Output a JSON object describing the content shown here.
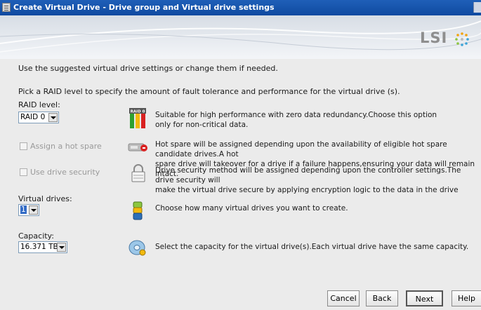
{
  "window": {
    "title": "Create Virtual Drive - Drive group and Virtual drive settings"
  },
  "brand": {
    "logo_text": "LSI"
  },
  "intro": {
    "line1": "Use the suggested virtual drive settings or change them if needed.",
    "line2": "Pick a RAID level to specify the amount of fault tolerance and performance for the virtual drive (s)."
  },
  "raid": {
    "label": "RAID level:",
    "value": "RAID 0",
    "icon_badge": "RAID 0",
    "description_line1": "Suitable for high performance with zero data redundancy.Choose this option",
    "description_line2": "only for non-critical data."
  },
  "hot_spare": {
    "label": "Assign a hot spare",
    "checked": false,
    "enabled": false,
    "description_line1": "Hot spare will be assigned depending upon the availability of eligible hot spare candidate drives.A hot",
    "description_line2": "spare drive will takeover for a drive if a failure happens,ensuring your data will remain intact."
  },
  "security": {
    "label": "Use drive security",
    "checked": false,
    "enabled": false,
    "description_line1": "Drive security method will be assigned depending upon the controller settings.The drive security will",
    "description_line2": "make the virtual drive secure by applying encryption logic to the data in the drive"
  },
  "virtual_drives": {
    "label": "Virtual drives:",
    "value": "1",
    "description": "Choose how many virtual drives you want to create."
  },
  "capacity": {
    "label": "Capacity:",
    "value": "16.371 TB",
    "description": "Select the capacity for the virtual drive(s).Each virtual drive have the same capacity."
  },
  "buttons": {
    "cancel": "Cancel",
    "back": "Back",
    "next": "Next",
    "help": "Help"
  },
  "colors": {
    "title_bar": "#0f4aa0",
    "selection": "#316ac5",
    "logo_gray": "#8e8e8e"
  },
  "icons": [
    "raid-stack-icon",
    "hot-spare-drive-icon",
    "padlock-icon",
    "database-stack-icon",
    "capacity-disk-icon"
  ]
}
